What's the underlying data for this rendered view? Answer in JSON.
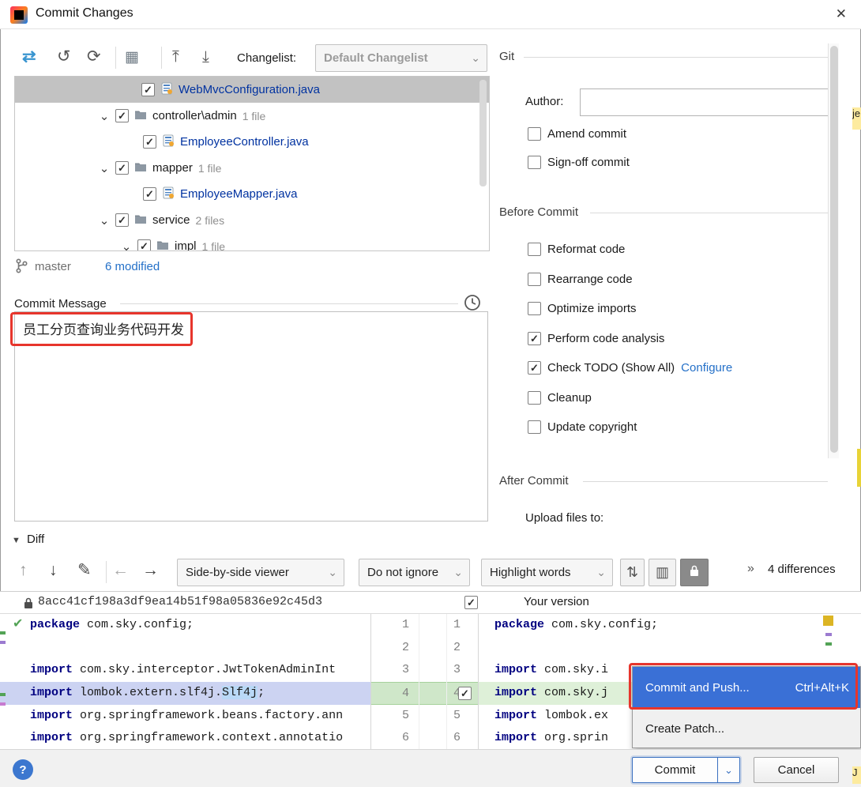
{
  "window": {
    "title": "Commit Changes"
  },
  "icons": {
    "refresh_vcs": "⇄",
    "rollback": "↺",
    "refresh": "⟳",
    "group_by": "▦",
    "expand_all": "⤒",
    "collapse_all": "⤓",
    "chevron_down": "⌄",
    "tree_chevron": "⌄",
    "up_arrow": "↑",
    "down_arrow": "↓",
    "edit": "✎",
    "left_arrow": "←",
    "right_arrow": "→",
    "collapse_unchanged": "⇅",
    "split_view": "▥",
    "more_chevrons": "»",
    "diff_expander": "▼",
    "close": "✕",
    "help": "?",
    "green_check": "✔"
  },
  "colors": {
    "modified_file_blue": "#0032a0",
    "menu_selection_blue": "#3a70d6",
    "highlight_red": "#e7352c",
    "link_blue": "#2470c8",
    "added_line_green": "#def0d8",
    "caret_line_lavender": "#ccd3f2"
  },
  "toolbar": {
    "changelist_label": "Changelist:",
    "changelist_value": "Default Changelist"
  },
  "tree": {
    "rows": [
      {
        "label": "WebMvcConfiguration.java",
        "check": "✓"
      },
      {
        "label": "controller\\admin",
        "count": "1 file",
        "check": "✓"
      },
      {
        "label": "EmployeeController.java",
        "check": "✓"
      },
      {
        "label": "mapper",
        "count": "1 file",
        "check": "✓"
      },
      {
        "label": "EmployeeMapper.java",
        "check": "✓"
      },
      {
        "label": "service",
        "count": "2 files",
        "check": "✓"
      },
      {
        "label": "impl",
        "count": "1 file",
        "check": "✓"
      }
    ]
  },
  "branch": {
    "name": "master",
    "modified": "6 modified"
  },
  "commit_message": {
    "label": "Commit Message",
    "text": "员工分页查询业务代码开发"
  },
  "options": {
    "git_title": "Git",
    "author_label": "Author:",
    "author_value": "",
    "amend": {
      "label": "Amend commit",
      "check": ""
    },
    "signoff": {
      "label": "Sign-off commit",
      "check": ""
    },
    "before_title": "Before Commit",
    "items": [
      {
        "label": "Reformat code",
        "check": ""
      },
      {
        "label": "Rearrange code",
        "check": ""
      },
      {
        "label": "Optimize imports",
        "check": ""
      },
      {
        "label": "Perform code analysis",
        "check": "✓"
      },
      {
        "label": "Check TODO (Show All)",
        "check": "✓",
        "link": "Configure"
      },
      {
        "label": "Cleanup",
        "check": ""
      },
      {
        "label": "Update copyright",
        "check": ""
      }
    ],
    "after_title": "After Commit",
    "upload_label": "Upload files to:"
  },
  "diff": {
    "title": "Diff",
    "viewer": "Side-by-side viewer",
    "ignore": "Do not ignore",
    "highlight": "Highlight words",
    "differences": "4 differences",
    "left_header": "8acc41cf198a3df9ea14b51f98a05836e92c45d3",
    "right_header": "Your version",
    "header_check": "✓",
    "row4_check": "✓",
    "left": [
      {
        "num": "1",
        "kw": "package",
        "rest": " com.sky.config;"
      },
      {
        "num": "2",
        "kw": "",
        "rest": ""
      },
      {
        "num": "3",
        "kw": "import",
        "rest": " com.sky.interceptor.JwtTokenAdminInt"
      },
      {
        "num": "4",
        "kw": "import",
        "mid": " lombok.extern.slf4j.",
        "token": "Slf4j",
        "end": ";"
      },
      {
        "num": "5",
        "kw": "import",
        "rest": " org.springframework.beans.factory.ann"
      },
      {
        "num": "6",
        "kw": "import",
        "rest": " org.springframework.context.annotatio"
      }
    ],
    "right": [
      {
        "num": "1",
        "kw": "package",
        "rest": " com.sky.config;"
      },
      {
        "num": "2",
        "kw": "",
        "rest": ""
      },
      {
        "num": "3",
        "kw": "import",
        "rest": " com.sky.i"
      },
      {
        "num": "4",
        "kw": "import",
        "rest": " com.sky.j"
      },
      {
        "num": "5",
        "kw": "import",
        "rest": " lombok.ex"
      },
      {
        "num": "6",
        "kw": "import",
        "rest": " org.sprin"
      }
    ],
    "fragments": {
      "top": "je",
      "bottom": "J"
    }
  },
  "context_menu": {
    "items": [
      {
        "label": "Commit and Push...",
        "shortcut": "Ctrl+Alt+K"
      },
      {
        "label": "Create Patch..."
      }
    ]
  },
  "footer": {
    "commit": "Commit",
    "cancel": "Cancel"
  }
}
